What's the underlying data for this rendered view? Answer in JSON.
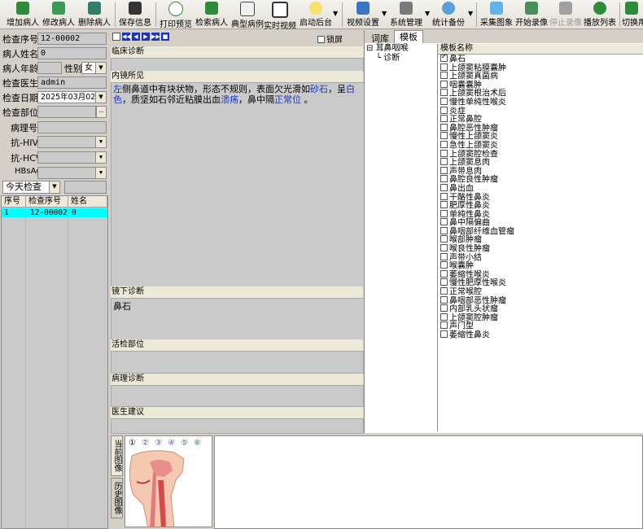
{
  "toolbar": {
    "add": "增加病人",
    "edit": "修改病人",
    "delete": "删除病人",
    "save": "保存信息",
    "print": "打印预览",
    "search": "检索病人",
    "typical": "典型病例",
    "realtime": "实时视频",
    "startbg": "启动后台",
    "video_settings": "视频设置",
    "system": "系统管理",
    "stats": "统计备份",
    "capture": "采集图象",
    "record": "开始录像",
    "stop_record": "停止录像",
    "playlist": "播放列表",
    "switch": "切换用"
  },
  "form": {
    "exam_no_label": "检查序号",
    "exam_no": "12-00002",
    "name_label": "病人姓名",
    "name": "0",
    "age_label": "病人年龄",
    "age": "",
    "gender_label": "性别",
    "gender": "女",
    "doctor_label": "检查医生",
    "doctor": "admin",
    "date_label": "检查日期",
    "date": "2025年03月02日",
    "site_label": "检查部位",
    "site": "",
    "site_btn": "..",
    "pathology_label": "病理号",
    "pathology": "",
    "hiv_label": "抗-HIV",
    "hiv": "",
    "hcv_label": "抗-HCV",
    "hcv": "",
    "hbsag_label": "HBsAg",
    "hbsag": ""
  },
  "filter": {
    "range": "今天检查",
    "value": ""
  },
  "patient_table": {
    "headers": [
      "序号",
      "检查序号",
      "姓名"
    ],
    "rows": [
      {
        "seq": "1",
        "exam_no": "12-00002",
        "name": "0"
      }
    ]
  },
  "report": {
    "lock_label": "锁屏",
    "clinical_label": "临床诊断",
    "clinical": "",
    "findings_label": "内镜所见",
    "findings": [
      {
        "t": "左",
        "h": true
      },
      {
        "t": "侧鼻道中有块状物，形态不规则，表面欠光滑如",
        "h": false
      },
      {
        "t": "砂石",
        "h": true
      },
      {
        "t": "，呈",
        "h": false
      },
      {
        "t": "白色",
        "h": true
      },
      {
        "t": "，质坚如石邻近粘膜出血",
        "h": false
      },
      {
        "t": "溃疡",
        "h": true
      },
      {
        "t": "，鼻中隔",
        "h": false
      },
      {
        "t": "正常位",
        "h": true
      },
      {
        "t": " 。",
        "h": false
      }
    ],
    "diagnosis_label": "镜下诊断",
    "diagnosis": "鼻石",
    "biopsy_label": "活检部位",
    "biopsy": "",
    "pathology_label": "病理诊断",
    "pathology": "",
    "advice_label": "医生建议",
    "advice": ""
  },
  "image_tabs": {
    "current": "当前图像",
    "history": "历史图像"
  },
  "image_markers": [
    "①",
    "②",
    "③",
    "④",
    "⑤",
    "⑥"
  ],
  "lexicon": {
    "tab_lexicon": "词库",
    "tab_template": "模板",
    "tree_root": "耳鼻咽喉",
    "tree_child": "诊断",
    "header": "模板名称",
    "items": [
      "鼻石",
      "上颌窦粘膜囊肿",
      "上颌窦真菌病",
      "咽囊囊肿",
      "上颌窦根治术后",
      "慢性单纯性喉炎",
      "炎症",
      "正常鼻腔",
      "鼻腔恶性肿瘤",
      "慢性上颌窦炎",
      "急性上颌窦炎",
      "上颌窦腔检查",
      "上颌窦息肉",
      "声带息肉",
      "鼻腔良性肿瘤",
      "鼻出血",
      "干酪性鼻炎",
      "肥厚性鼻炎",
      "单纯性鼻炎",
      "鼻中隔偏曲",
      "鼻咽部纤维血管瘤",
      "喉部肿瘤",
      "喉良性肿瘤",
      "声带小结",
      "喉囊肿",
      "萎缩性喉炎",
      "慢性肥厚性喉炎",
      "正常喉腔",
      "鼻咽部恶性肿瘤",
      "内部乳头状瘤",
      "上颌窦腔肿瘤",
      "声门型",
      "萎缩性鼻炎"
    ]
  },
  "colors": {
    "selected_row": "#00ffff",
    "highlight_text": "#1a35b8",
    "panel": "#cacaca"
  }
}
